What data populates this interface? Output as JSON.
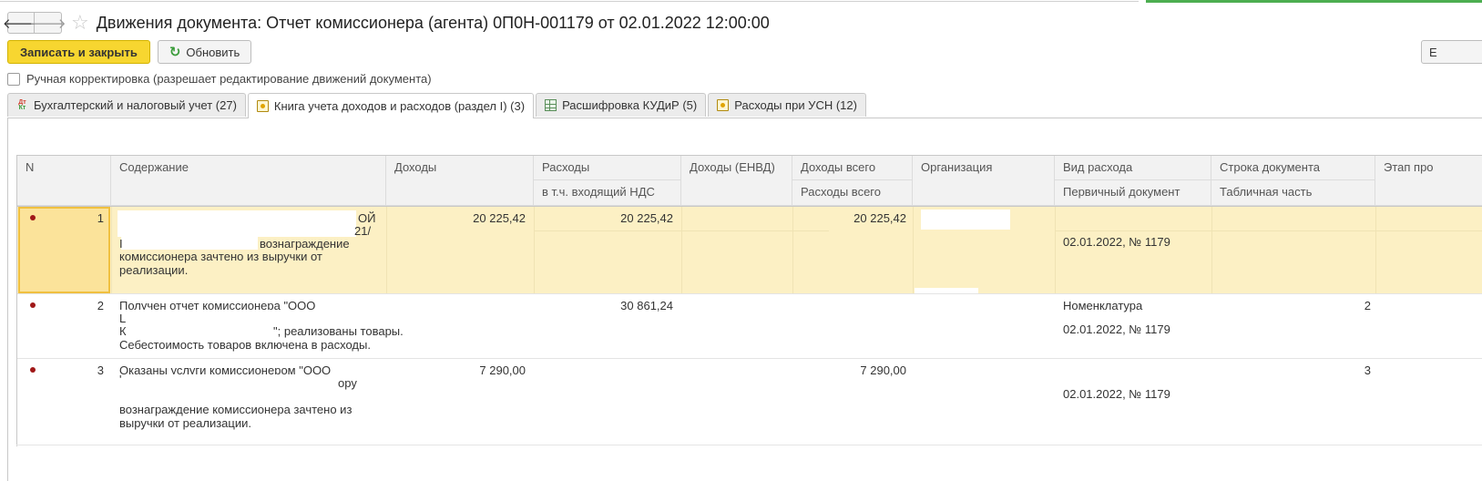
{
  "window": {
    "title": "Движения документа: Отчет комиссионера (агента) 0П0Н-001179 от 02.01.2022 12:00:00",
    "nav_back": "🡐",
    "nav_forward": "🡒",
    "favorite_icon": "star-icon"
  },
  "toolbar": {
    "save_close_label": "Записать и закрыть",
    "refresh_label": "Обновить",
    "right_button_label": "Е"
  },
  "manual_edit": {
    "label": "Ручная корректировка (разрешает редактирование движений документа)",
    "checked": false
  },
  "tabs": [
    {
      "label": "Бухгалтерский и налоговый учет (27)",
      "icon": "dt-kt-icon",
      "active": false
    },
    {
      "label": "Книга учета доходов и расходов (раздел I) (3)",
      "icon": "book-icon",
      "active": true
    },
    {
      "label": "Расшифровка КУДиР (5)",
      "icon": "grid-icon",
      "active": false
    },
    {
      "label": "Расходы при УСН (12)",
      "icon": "book-icon",
      "active": false
    }
  ],
  "table": {
    "headers": {
      "n": "N",
      "content": "Содержание",
      "income": "Доходы",
      "expenses": "Расходы",
      "expenses_vat": "в т.ч. входящий НДС",
      "income_envd": "Доходы (ЕНВД)",
      "income_total": "Доходы всего",
      "expenses_total": "Расходы всего",
      "organization": "Организация",
      "expense_type": "Вид расхода",
      "primary_doc": "Первичный документ",
      "doc_line": "Строка документа",
      "table_part": "Табличная часть",
      "stage": "Этап про"
    },
    "rows": [
      {
        "n": "1",
        "content_a": "ОЙ",
        "content_b": "21/",
        "content_c": "вознаграждение",
        "content_d": "комиссионера зачтено из выручки от\nреализации.",
        "income": "20 225,42",
        "expenses": "20 225,42",
        "income_total": "20 225,42",
        "expense_type": "",
        "primary_doc": "02.01.2022, № 1179",
        "doc_line": ""
      },
      {
        "n": "2",
        "content_a": "Получен отчет комиссионера \"ООО \"ЦВЕТНОЙ",
        "content_b": "L",
        "content_c": "К",
        "content_d": "\"; реализованы товары.",
        "content_e": "Себестоимость товаров включена в расходы.",
        "income": "",
        "expenses": "30 861,24",
        "income_total": "",
        "expense_type": "Номенклатура",
        "primary_doc": "02.01.2022, № 1179",
        "doc_line": "2"
      },
      {
        "n": "3",
        "content_a": "Оказаны услуги комиссионером \"ООО",
        "content_b": "ору",
        "content_c": "вознаграждение комиссионера зачтено из\nвыручки от реализации.",
        "income": "7 290,00",
        "expenses": "",
        "income_total": "7 290,00",
        "expense_type": "",
        "primary_doc": "02.01.2022, № 1179",
        "doc_line": "3"
      }
    ]
  },
  "colors": {
    "primary_button": "#f7d630",
    "selected_row": "#fcf0c4",
    "selected_cell": "#fbe39a",
    "marker_dot": "#a01818",
    "accent_green": "#4cae50"
  }
}
